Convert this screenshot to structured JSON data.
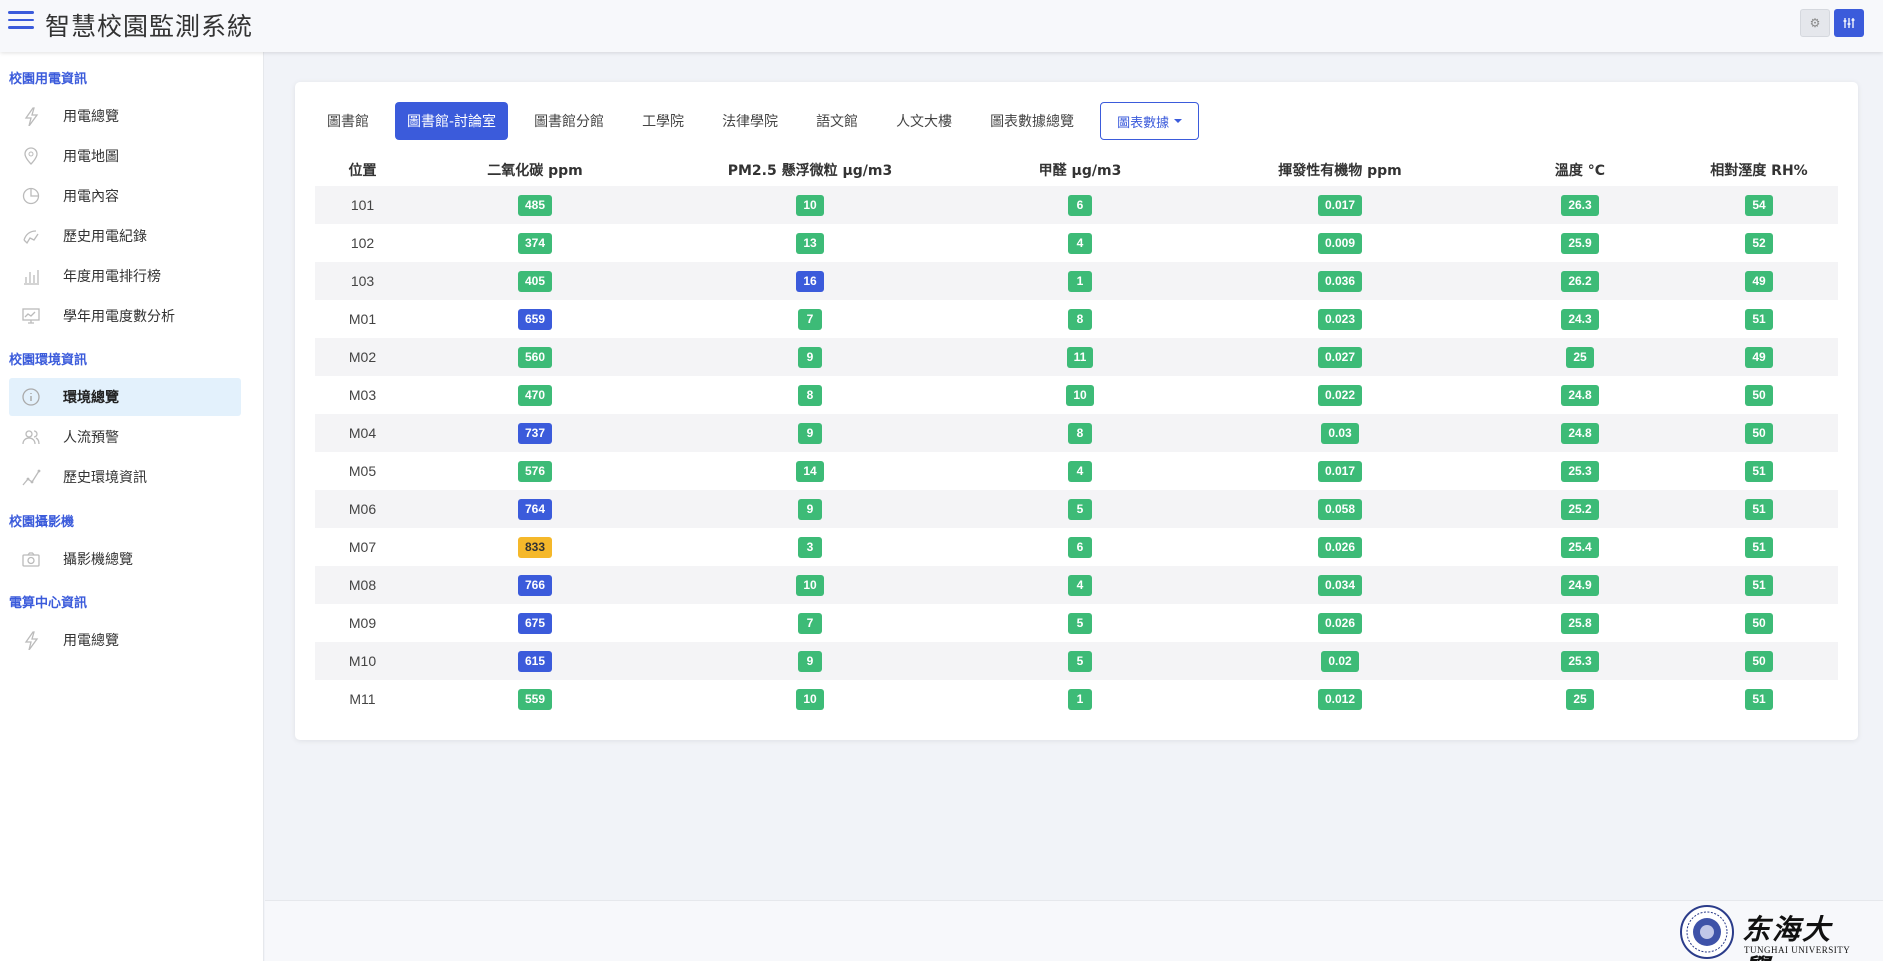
{
  "app": {
    "title": "智慧校園監測系統"
  },
  "sidebar": {
    "sections": [
      {
        "title": "校園用電資訊",
        "items": [
          {
            "label": "用電總覽",
            "icon": "lightning-icon"
          },
          {
            "label": "用電地圖",
            "icon": "map-pin-icon"
          },
          {
            "label": "用電內容",
            "icon": "pie-chart-icon"
          },
          {
            "label": "歷史用電紀錄",
            "icon": "history-chart-icon"
          },
          {
            "label": "年度用電排行榜",
            "icon": "bar-chart-icon"
          },
          {
            "label": "學年用電度數分析",
            "icon": "monitor-chart-icon"
          }
        ]
      },
      {
        "title": "校園環境資訊",
        "items": [
          {
            "label": "環境總覽",
            "icon": "info-icon",
            "active": true
          },
          {
            "label": "人流預警",
            "icon": "users-icon"
          },
          {
            "label": "歷史環境資訊",
            "icon": "line-chart-icon"
          }
        ]
      },
      {
        "title": "校園攝影機",
        "items": [
          {
            "label": "攝影機總覽",
            "icon": "camera-icon"
          }
        ]
      },
      {
        "title": "電算中心資訊",
        "items": [
          {
            "label": "用電總覽",
            "icon": "lightning-icon"
          }
        ]
      }
    ]
  },
  "tabs": [
    {
      "label": "圖書館"
    },
    {
      "label": "圖書館-討論室",
      "active": true
    },
    {
      "label": "圖書館分館"
    },
    {
      "label": "工學院"
    },
    {
      "label": "法律學院"
    },
    {
      "label": "語文館"
    },
    {
      "label": "人文大樓"
    },
    {
      "label": "圖表數據總覽"
    }
  ],
  "dropdown_label": "圖表數據",
  "table": {
    "headers": [
      "位置",
      "二氧化碳 ppm",
      "PM2.5 懸浮微粒 µg/m3",
      "甲醛 µg/m3",
      "揮發性有機物 ppm",
      "溫度 °C",
      "相對溼度 RH%"
    ],
    "rows": [
      {
        "loc": "101",
        "co2": "485",
        "co2_level": "green",
        "pm25": "10",
        "pm_level": "green",
        "hcho": "6",
        "voc": "0.017",
        "temp": "26.3",
        "rh": "54"
      },
      {
        "loc": "102",
        "co2": "374",
        "co2_level": "green",
        "pm25": "13",
        "pm_level": "green",
        "hcho": "4",
        "voc": "0.009",
        "temp": "25.9",
        "rh": "52"
      },
      {
        "loc": "103",
        "co2": "405",
        "co2_level": "green",
        "pm25": "16",
        "pm_level": "blue",
        "hcho": "1",
        "voc": "0.036",
        "temp": "26.2",
        "rh": "49"
      },
      {
        "loc": "M01",
        "co2": "659",
        "co2_level": "blue",
        "pm25": "7",
        "pm_level": "green",
        "hcho": "8",
        "voc": "0.023",
        "temp": "24.3",
        "rh": "51"
      },
      {
        "loc": "M02",
        "co2": "560",
        "co2_level": "green",
        "pm25": "9",
        "pm_level": "green",
        "hcho": "11",
        "voc": "0.027",
        "temp": "25",
        "rh": "49"
      },
      {
        "loc": "M03",
        "co2": "470",
        "co2_level": "green",
        "pm25": "8",
        "pm_level": "green",
        "hcho": "10",
        "voc": "0.022",
        "temp": "24.8",
        "rh": "50"
      },
      {
        "loc": "M04",
        "co2": "737",
        "co2_level": "blue",
        "pm25": "9",
        "pm_level": "green",
        "hcho": "8",
        "voc": "0.03",
        "temp": "24.8",
        "rh": "50"
      },
      {
        "loc": "M05",
        "co2": "576",
        "co2_level": "green",
        "pm25": "14",
        "pm_level": "green",
        "hcho": "4",
        "voc": "0.017",
        "temp": "25.3",
        "rh": "51"
      },
      {
        "loc": "M06",
        "co2": "764",
        "co2_level": "blue",
        "pm25": "9",
        "pm_level": "green",
        "hcho": "5",
        "voc": "0.058",
        "temp": "25.2",
        "rh": "51"
      },
      {
        "loc": "M07",
        "co2": "833",
        "co2_level": "yellow",
        "pm25": "3",
        "pm_level": "green",
        "hcho": "6",
        "voc": "0.026",
        "temp": "25.4",
        "rh": "51"
      },
      {
        "loc": "M08",
        "co2": "766",
        "co2_level": "blue",
        "pm25": "10",
        "pm_level": "green",
        "hcho": "4",
        "voc": "0.034",
        "temp": "24.9",
        "rh": "51"
      },
      {
        "loc": "M09",
        "co2": "675",
        "co2_level": "blue",
        "pm25": "7",
        "pm_level": "green",
        "hcho": "5",
        "voc": "0.026",
        "temp": "25.8",
        "rh": "50"
      },
      {
        "loc": "M10",
        "co2": "615",
        "co2_level": "blue",
        "pm25": "9",
        "pm_level": "green",
        "hcho": "5",
        "voc": "0.02",
        "temp": "25.3",
        "rh": "50"
      },
      {
        "loc": "M11",
        "co2": "559",
        "co2_level": "green",
        "pm25": "10",
        "pm_level": "green",
        "hcho": "1",
        "voc": "0.012",
        "temp": "25",
        "rh": "51"
      }
    ]
  },
  "footer": {
    "logo_cn": "东海大學",
    "logo_en": "TUNGHAI UNIVERSITY"
  },
  "colors": {
    "accent": "#3b5bdb",
    "good": "#3dbb77",
    "warn": "#f5b82a",
    "active_bg": "#e3f1fc"
  }
}
